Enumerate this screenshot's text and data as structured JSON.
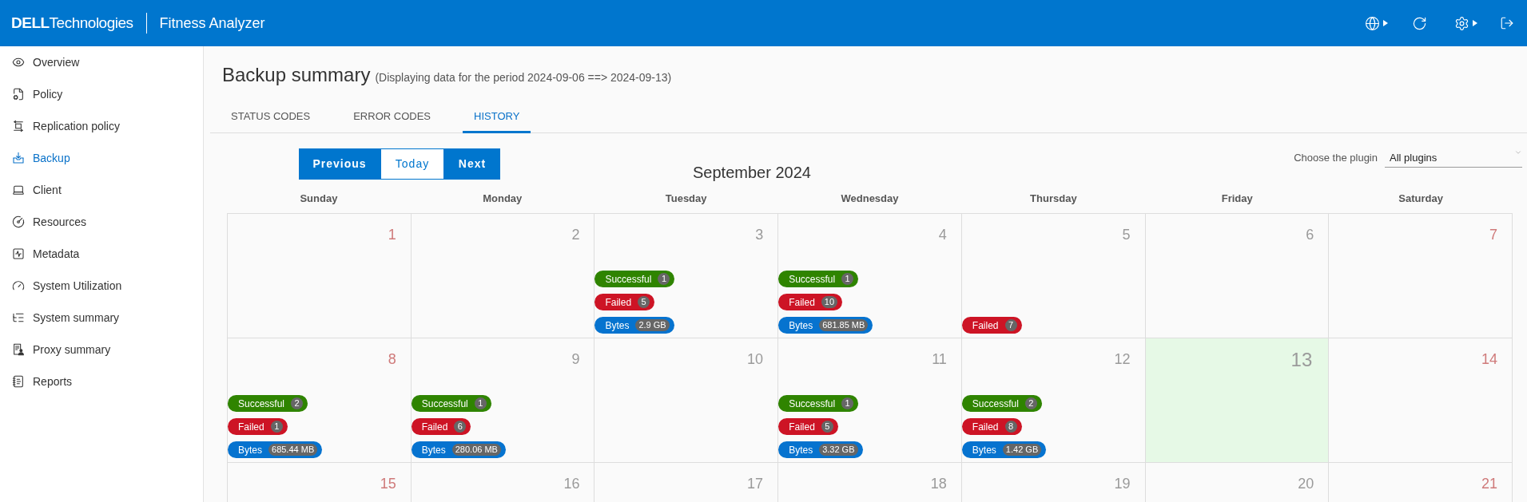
{
  "header": {
    "logo": "**DELL**Technologies",
    "app_title": "Fitness Analyzer"
  },
  "sidebar": {
    "items": [
      {
        "label": "Overview",
        "selected": false
      },
      {
        "label": "Policy",
        "selected": false
      },
      {
        "label": "Replication policy",
        "selected": false
      },
      {
        "label": "Backup",
        "selected": true
      },
      {
        "label": "Client",
        "selected": false
      },
      {
        "label": "Resources",
        "selected": false
      },
      {
        "label": "Metadata",
        "selected": false
      },
      {
        "label": "System Utilization",
        "selected": false
      },
      {
        "label": "System summary",
        "selected": false
      },
      {
        "label": "Proxy summary",
        "selected": false
      },
      {
        "label": "Reports",
        "selected": false
      }
    ]
  },
  "page": {
    "title": "Backup summary",
    "subtitle": "(Displaying data for the period 2024-09-06 ==> 2024-09-13)"
  },
  "tabs": [
    {
      "label": "STATUS CODES",
      "selected": false
    },
    {
      "label": "ERROR CODES",
      "selected": false
    },
    {
      "label": "HISTORY",
      "selected": true
    }
  ],
  "calendar": {
    "nav_buttons": [
      {
        "label": "Previous",
        "kind": "filled"
      },
      {
        "label": "Today",
        "kind": "outline"
      },
      {
        "label": "Next",
        "kind": "filled"
      }
    ],
    "month": "September 2024",
    "plugin_filter": {
      "label": "Choose the plugin",
      "value": "All plugins"
    },
    "weekdays": [
      "Sunday",
      "Monday",
      "Tuesday",
      "Wednesday",
      "Thursday",
      "Friday",
      "Saturday"
    ],
    "weeks": [
      {
        "days": [
          {
            "date": "1",
            "weekend": true,
            "today": false
          },
          {
            "date": "2",
            "weekend": false,
            "today": false
          },
          {
            "date": "3",
            "weekend": false,
            "today": false,
            "tags": [
              {
                "label": "Successful",
                "count": "1",
                "color": "#2f8400"
              },
              {
                "label": "Failed",
                "count": "5",
                "color": "#cd1425"
              },
              {
                "label": "Bytes",
                "count": "2.9 GB",
                "color": "#0673cf"
              }
            ]
          },
          {
            "date": "4",
            "weekend": false,
            "today": false,
            "tags": [
              {
                "label": "Successful",
                "count": "1",
                "color": "#2f8400"
              },
              {
                "label": "Failed",
                "count": "10",
                "color": "#cd1425"
              },
              {
                "label": "Bytes",
                "count": "681.85 MB",
                "color": "#0673cf"
              }
            ]
          },
          {
            "date": "5",
            "weekend": false,
            "today": false,
            "tags": [
              {
                "label": "Failed",
                "count": "7",
                "color": "#cd1425"
              }
            ]
          },
          {
            "date": "6",
            "weekend": false,
            "today": false
          },
          {
            "date": "7",
            "weekend": true,
            "today": false
          }
        ]
      },
      {
        "days": [
          {
            "date": "8",
            "weekend": true,
            "today": false,
            "tags": [
              {
                "label": "Successful",
                "count": "2",
                "color": "#2f8400"
              },
              {
                "label": "Failed",
                "count": "1",
                "color": "#cd1425"
              },
              {
                "label": "Bytes",
                "count": "685.44 MB",
                "color": "#0673cf"
              }
            ]
          },
          {
            "date": "9",
            "weekend": false,
            "today": false,
            "tags": [
              {
                "label": "Successful",
                "count": "1",
                "color": "#2f8400"
              },
              {
                "label": "Failed",
                "count": "6",
                "color": "#cd1425"
              },
              {
                "label": "Bytes",
                "count": "280.06 MB",
                "color": "#0673cf"
              }
            ]
          },
          {
            "date": "10",
            "weekend": false,
            "today": false
          },
          {
            "date": "11",
            "weekend": false,
            "today": false,
            "tags": [
              {
                "label": "Successful",
                "count": "1",
                "color": "#2f8400"
              },
              {
                "label": "Failed",
                "count": "5",
                "color": "#cd1425"
              },
              {
                "label": "Bytes",
                "count": "3.32 GB",
                "color": "#0673cf"
              }
            ]
          },
          {
            "date": "12",
            "weekend": false,
            "today": false,
            "tags": [
              {
                "label": "Successful",
                "count": "2",
                "color": "#2f8400"
              },
              {
                "label": "Failed",
                "count": "8",
                "color": "#cd1425"
              },
              {
                "label": "Bytes",
                "count": "1.42 GB",
                "color": "#0673cf"
              }
            ]
          },
          {
            "date": "13",
            "weekend": false,
            "today": true
          },
          {
            "date": "14",
            "weekend": true,
            "today": false
          }
        ]
      },
      {
        "days": [
          {
            "date": "15",
            "weekend": true,
            "today": false
          },
          {
            "date": "16",
            "weekend": false,
            "today": false
          },
          {
            "date": "17",
            "weekend": false,
            "today": false
          },
          {
            "date": "18",
            "weekend": false,
            "today": false
          },
          {
            "date": "19",
            "weekend": false,
            "today": false
          },
          {
            "date": "20",
            "weekend": false,
            "today": false
          },
          {
            "date": "21",
            "weekend": true,
            "today": false
          }
        ]
      }
    ]
  }
}
